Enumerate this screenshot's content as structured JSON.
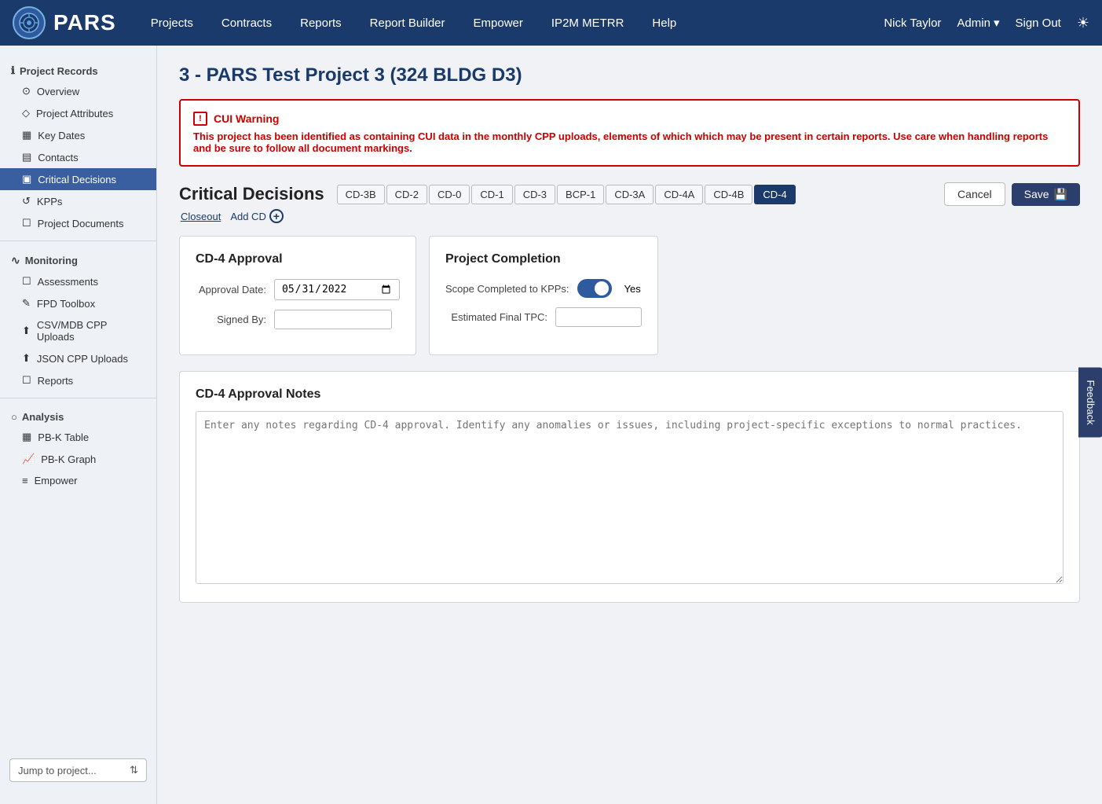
{
  "app": {
    "logo_text": "PARS",
    "logo_circle_text": "⚙"
  },
  "nav": {
    "links": [
      "Projects",
      "Contracts",
      "Reports",
      "Report Builder",
      "Empower",
      "IP2M METRR",
      "Help"
    ],
    "user": "Nick Taylor",
    "admin_label": "Admin",
    "signout_label": "Sign Out"
  },
  "sidebar": {
    "project_records_label": "Project Records",
    "items_project": [
      {
        "label": "Overview",
        "icon": "⊙"
      },
      {
        "label": "Project Attributes",
        "icon": "◇"
      },
      {
        "label": "Key Dates",
        "icon": "▦"
      },
      {
        "label": "Contacts",
        "icon": "▤"
      },
      {
        "label": "Critical Decisions",
        "icon": "▣",
        "active": true
      },
      {
        "label": "KPPs",
        "icon": "↺"
      },
      {
        "label": "Project Documents",
        "icon": "☐"
      }
    ],
    "monitoring_label": "Monitoring",
    "items_monitoring": [
      {
        "label": "Assessments",
        "icon": "☐"
      },
      {
        "label": "FPD Toolbox",
        "icon": "✎"
      },
      {
        "label": "CSV/MDB CPP Uploads",
        "icon": "⬆"
      },
      {
        "label": "JSON CPP Uploads",
        "icon": "⬆"
      },
      {
        "label": "Reports",
        "icon": "☐"
      }
    ],
    "analysis_label": "Analysis",
    "items_analysis": [
      {
        "label": "PB-K Table",
        "icon": "▦"
      },
      {
        "label": "PB-K Graph",
        "icon": "📈"
      },
      {
        "label": "Empower",
        "icon": "≡"
      }
    ],
    "jump_placeholder": "Jump to project..."
  },
  "page": {
    "title": "3 - PARS Test Project 3 (324 BLDG D3)"
  },
  "cui_warning": {
    "title": "CUI Warning",
    "text": "This project has been identified as containing CUI data in the monthly CPP uploads, elements of which which may be present in certain reports. Use care when handling reports and be sure to follow all document markings."
  },
  "critical_decisions": {
    "heading": "Critical Decisions",
    "tabs": [
      "CD-3B",
      "CD-2",
      "CD-0",
      "CD-1",
      "CD-3",
      "BCP-1",
      "CD-3A",
      "CD-4A",
      "CD-4B",
      "CD-4"
    ],
    "active_tab": "CD-4",
    "closeout_label": "Closeout",
    "add_cd_label": "Add CD",
    "cancel_label": "Cancel",
    "save_label": "Save"
  },
  "cd4_approval": {
    "panel_title": "CD-4 Approval",
    "approval_date_label": "Approval Date:",
    "approval_date_value": "05/31/2022",
    "signed_by_label": "Signed By:",
    "signed_by_value": ""
  },
  "project_completion": {
    "panel_title": "Project Completion",
    "scope_label": "Scope Completed to KPPs:",
    "scope_value": "Yes",
    "tpc_label": "Estimated Final TPC:",
    "tpc_value": ""
  },
  "cd4_notes": {
    "title": "CD-4 Approval Notes",
    "placeholder": "Enter any notes regarding CD-4 approval. Identify any anomalies or issues, including project-specific exceptions to normal practices.",
    "value": ""
  },
  "feedback": {
    "label": "Feedback"
  }
}
